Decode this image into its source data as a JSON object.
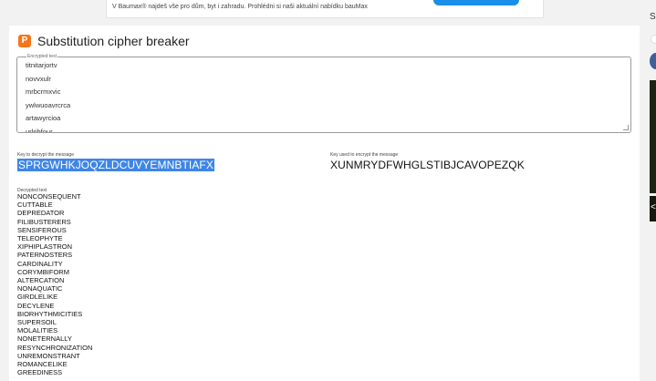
{
  "ad": {
    "text": "V Baumax® najdeš vše pro dům, byt i zahradu. Prohlédni si naši aktuální nabídku bauMax"
  },
  "app": {
    "title": "Substitution cipher breaker",
    "icon": "cipher-app-icon"
  },
  "encrypted": {
    "legend": "Encrypted text",
    "lines": [
      "titnitarjortv",
      "novvxulr",
      "mrbcrmxvic",
      "ywlwuoavrcrca",
      "artawyrcioa",
      "urlrihfour"
    ]
  },
  "keys": {
    "decrypt_label": "Key to decrypt the message",
    "decrypt_value": "SPRGWHKJOQZLDCUVYEMNBTIAFX",
    "encrypt_label": "Key used to encrypt the message",
    "encrypt_value": "XUNMRYDFWHGLSTIBJCAVOPEZQK"
  },
  "decrypted": {
    "label": "Decrypted text",
    "words": [
      "NONCONSEQUENT",
      "CUTTABLE",
      "DEPREDATOR",
      "FILIBUSTERERS",
      "SENSIFEROUS",
      "TELEOPHYTE",
      "XIPHIPLASTRON",
      "PATERNOSTERS",
      "CARDINALITY",
      "CORYMBIFORM",
      "ALTERCATION",
      "NONAQUATIC",
      "GIRDLELIKE",
      "DECYLENE",
      "BIORHYTHMICITIES",
      "SUPERSOIL",
      "MOLALITIES",
      "NONETERNALLY",
      "RESYNCHRONIZATION",
      "UNREMONSTRANT",
      "ROMANCELIKE",
      "GREEDINESS"
    ]
  },
  "sidebar": {
    "letter": "S",
    "arrow": "<"
  },
  "colors": {
    "accent": "#f5761a",
    "selection": "#3e86e6",
    "cta": "#1a8fe8"
  }
}
